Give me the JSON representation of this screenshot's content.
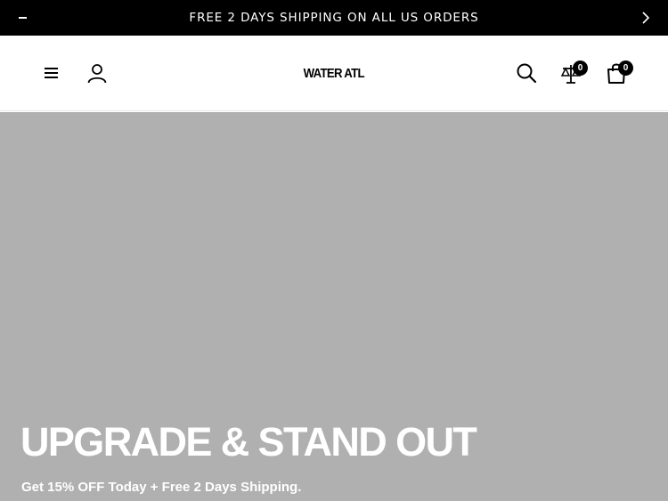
{
  "announcement": {
    "text": "FREE 2 DAYS SHIPPING ON ALL US ORDERS",
    "prev_icon": "minus-icon",
    "next_icon": "chevron-right-icon"
  },
  "header": {
    "logo": "WATER ATL",
    "icons": [
      "menu-icon",
      "account-icon",
      "search-icon",
      "compare-scale-icon",
      "shopping-bag-icon"
    ],
    "compare_count": "0",
    "cart_count": "0"
  },
  "hero": {
    "title": "UPGRADE & STAND OUT",
    "subtitle": "Get 15% OFF Today + Free 2 Days Shipping.",
    "background_color": "#b0b0b0"
  },
  "colors": {
    "announcement_bg": "#000000",
    "text_light": "#ffffff",
    "brand": "#000000"
  }
}
